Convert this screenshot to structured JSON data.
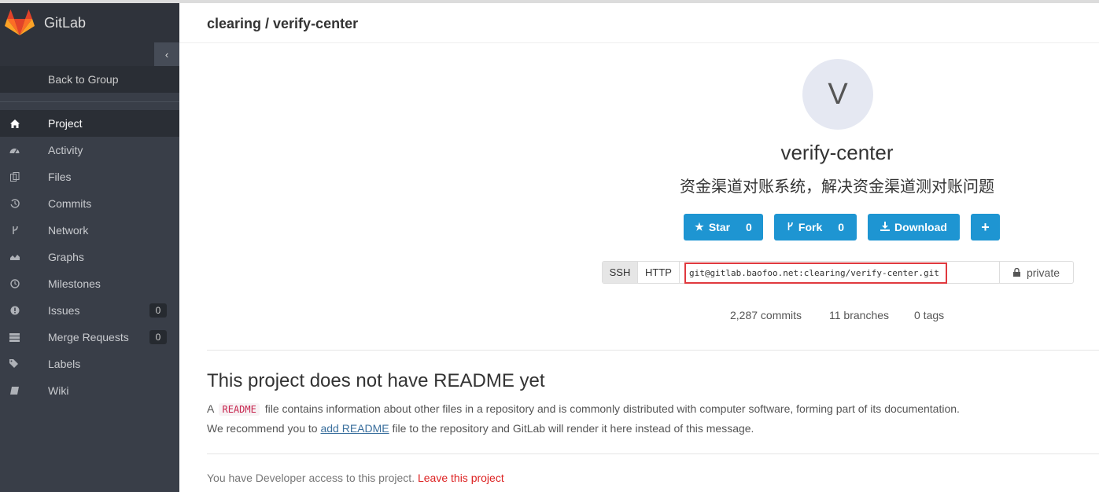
{
  "app": {
    "name": "GitLab"
  },
  "sidebar": {
    "collapse_icon": "chevron-left-icon",
    "back_label": "Back to Group",
    "items": [
      {
        "label": "Project",
        "icon": "home-icon",
        "active": true
      },
      {
        "label": "Activity",
        "icon": "dashboard-icon"
      },
      {
        "label": "Files",
        "icon": "files-icon"
      },
      {
        "label": "Commits",
        "icon": "history-icon"
      },
      {
        "label": "Network",
        "icon": "code-fork-icon"
      },
      {
        "label": "Graphs",
        "icon": "area-chart-icon"
      },
      {
        "label": "Milestones",
        "icon": "clock-icon"
      },
      {
        "label": "Issues",
        "icon": "exclamation-circle-icon",
        "badge": "0"
      },
      {
        "label": "Merge Requests",
        "icon": "tasks-icon",
        "badge": "0"
      },
      {
        "label": "Labels",
        "icon": "tags-icon"
      },
      {
        "label": "Wiki",
        "icon": "book-icon"
      }
    ]
  },
  "header": {
    "breadcrumb": "clearing / verify-center"
  },
  "project": {
    "avatar_letter": "V",
    "name": "verify-center",
    "description": "资金渠道对账系统，解决资金渠道测对账问题"
  },
  "actions": {
    "star": {
      "label": "Star",
      "count": "0"
    },
    "fork": {
      "label": "Fork",
      "count": "0"
    },
    "download": {
      "label": "Download"
    },
    "add": {
      "label": "+"
    }
  },
  "clone": {
    "ssh_label": "SSH",
    "http_label": "HTTP",
    "url": "git@gitlab.baofoo.net:clearing/verify-center.git",
    "visibility": "private"
  },
  "stats": {
    "commits": "2,287 commits",
    "branches": "11 branches",
    "tags": "0 tags"
  },
  "readme": {
    "title": "This project does not have README yet",
    "p1_prefix": "A",
    "p1_code": "README",
    "p1_suffix": "file contains information about other files in a repository and is commonly distributed with computer software, forming part of its documentation.",
    "p2_prefix": "We recommend you to",
    "p2_link": "add README",
    "p2_suffix": "file to the repository and GitLab will render it here instead of this message."
  },
  "access": {
    "text": "You have Developer access to this project.",
    "leave_link": "Leave this project"
  },
  "colors": {
    "sidebar_bg": "#393e48",
    "primary_button": "#1e95d2",
    "highlight_border": "#e0393e",
    "leave_link": "#dd2222"
  }
}
